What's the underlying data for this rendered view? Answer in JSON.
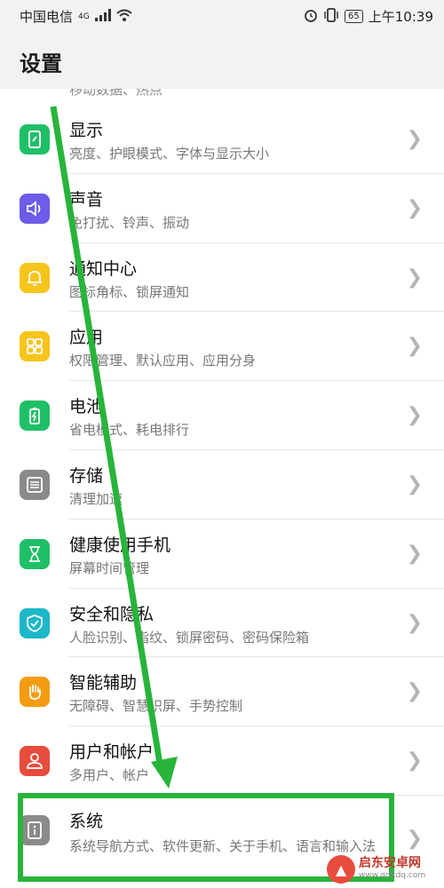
{
  "status_bar": {
    "carrier": "中国电信",
    "network": "4G",
    "battery": "65",
    "time": "上午10:39"
  },
  "header": {
    "title": "设置"
  },
  "peek_item": {
    "subtitle": "移动数据、热点"
  },
  "items": [
    {
      "title": "显示",
      "subtitle": "亮度、护眼模式、字体与显示大小",
      "icon": "display-icon",
      "color": "#1fbf68"
    },
    {
      "title": "声音",
      "subtitle": "免打扰、铃声、振动",
      "icon": "sound-icon",
      "color": "#6c5ce7"
    },
    {
      "title": "通知中心",
      "subtitle": "图标角标、锁屏通知",
      "icon": "bell-icon",
      "color": "#f7c41b"
    },
    {
      "title": "应用",
      "subtitle": "权限管理、默认应用、应用分身",
      "icon": "apps-grid-icon",
      "color": "#f7c41b"
    },
    {
      "title": "电池",
      "subtitle": "省电模式、耗电排行",
      "icon": "battery-icon",
      "color": "#1fbf68"
    },
    {
      "title": "存储",
      "subtitle": "清理加速",
      "icon": "storage-icon",
      "color": "#8a8a8a"
    },
    {
      "title": "健康使用手机",
      "subtitle": "屏幕时间管理",
      "icon": "hourglass-icon",
      "color": "#1fbf68"
    },
    {
      "title": "安全和隐私",
      "subtitle": "人脸识别、指纹、锁屏密码、密码保险箱",
      "icon": "shield-icon",
      "color": "#1cb8c9"
    },
    {
      "title": "智能辅助",
      "subtitle": "无障碍、智慧识屏、手势控制",
      "icon": "hand-icon",
      "color": "#f39c12"
    },
    {
      "title": "用户和帐户",
      "subtitle": "多用户、帐户",
      "icon": "user-icon",
      "color": "#e74c3c"
    },
    {
      "title": "系统",
      "subtitle": "系统导航方式、软件更新、关于手机、语言和输入法",
      "icon": "info-icon",
      "color": "#8a8a8a"
    }
  ],
  "annotation": {
    "color": "#28b43a"
  },
  "watermark": {
    "name": "启东安卓网",
    "url": "www.qdltdq.com"
  }
}
